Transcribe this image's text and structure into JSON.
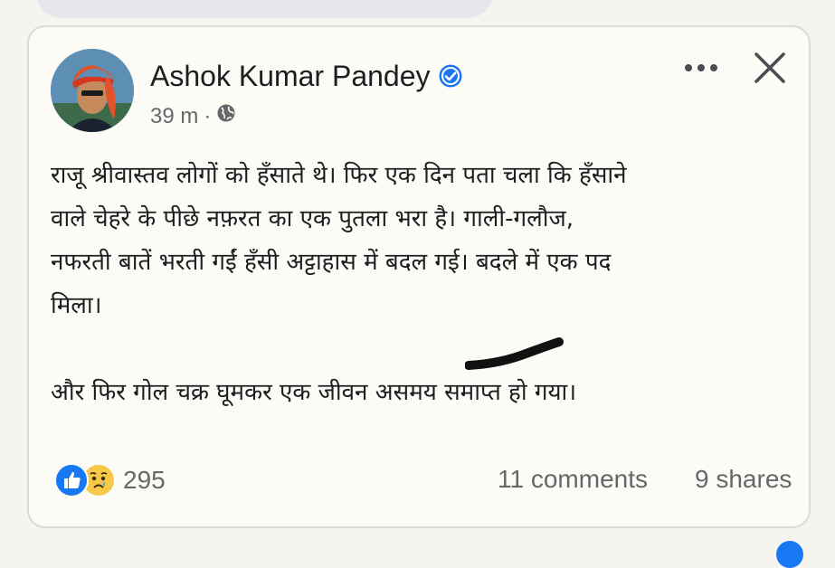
{
  "post": {
    "author": "Ashok Kumar Pandey",
    "time": "39 m",
    "separator": "·",
    "audience_icon": "globe-icon",
    "verified_icon": "verified-badge-icon",
    "lines": [
      "राजू श्रीवास्तव लोगों को हँसाते थे। फिर एक दिन पता चला कि हँसाने",
      "वाले चेहरे के पीछे नफ़रत का एक पुतला भरा है। गाली-गलौज,",
      "नफरती बातें भरती गईं हँसी अट्टाहास में बदल गई। बदले में एक पद",
      "मिला।",
      "और फिर गोल चक्र घूमकर एक जीवन असमय समाप्त हो गया।"
    ]
  },
  "footer": {
    "reaction_count": "295",
    "reaction_icons": [
      "like-icon",
      "sad-icon"
    ],
    "comments": "11 comments",
    "shares": "9 shares"
  },
  "colors": {
    "card_background": "#fcfbf5",
    "text": "#1c1e21",
    "secondary_text": "#65676b",
    "verified_blue": "#1877f2",
    "like_blue": "#1877f2",
    "sad_yellow": "#f7c948"
  }
}
